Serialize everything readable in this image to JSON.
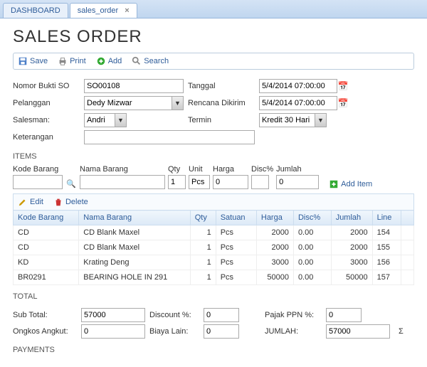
{
  "tabs": {
    "dashboard": "DASHBOARD",
    "sales_order": "sales_order"
  },
  "page_title": "SALES ORDER",
  "toolbar": {
    "save": "Save",
    "print": "Print",
    "add": "Add",
    "search": "Search"
  },
  "form": {
    "nomor_bukti_lbl": "Nomor Bukti SO",
    "nomor_bukti": "SO00108",
    "tanggal_lbl": "Tanggal",
    "tanggal": "5/4/2014 07:00:00",
    "pelanggan_lbl": "Pelanggan",
    "pelanggan": "Dedy Mizwar",
    "rencana_lbl": "Rencana Dikirim",
    "rencana": "5/4/2014 07:00:00",
    "salesman_lbl": "Salesman:",
    "salesman": "Andri",
    "termin_lbl": "Termin",
    "termin": "Kredit 30 Hari",
    "keterangan_lbl": "Keterangan",
    "keterangan": ""
  },
  "items_title": "ITEMS",
  "item_input": {
    "kode_lbl": "Kode Barang",
    "kode": "",
    "nama_lbl": "Nama Barang",
    "nama": "",
    "qty_lbl": "Qty",
    "qty": "1",
    "unit_lbl": "Unit",
    "unit": "Pcs",
    "harga_lbl": "Harga",
    "harga": "0",
    "disc_lbl": "Disc%",
    "disc": "",
    "jumlah_lbl": "Jumlah",
    "jumlah": "0",
    "add_item": "Add Item"
  },
  "grid_toolbar": {
    "edit": "Edit",
    "delete": "Delete"
  },
  "grid_headers": {
    "kode": "Kode Barang",
    "nama": "Nama Barang",
    "qty": "Qty",
    "satuan": "Satuan",
    "harga": "Harga",
    "disc": "Disc%",
    "jumlah": "Jumlah",
    "line": "Line"
  },
  "rows": [
    {
      "kode": "CD",
      "nama": "CD Blank Maxel",
      "qty": "1",
      "satuan": "Pcs",
      "harga": "2000",
      "disc": "0.00",
      "jumlah": "2000",
      "line": "154"
    },
    {
      "kode": "CD",
      "nama": "CD Blank Maxel",
      "qty": "1",
      "satuan": "Pcs",
      "harga": "2000",
      "disc": "0.00",
      "jumlah": "2000",
      "line": "155"
    },
    {
      "kode": "KD",
      "nama": "Krating Deng",
      "qty": "1",
      "satuan": "Pcs",
      "harga": "3000",
      "disc": "0.00",
      "jumlah": "3000",
      "line": "156"
    },
    {
      "kode": "BR0291",
      "nama": "BEARING HOLE IN 291",
      "qty": "1",
      "satuan": "Pcs",
      "harga": "50000",
      "disc": "0.00",
      "jumlah": "50000",
      "line": "157"
    }
  ],
  "total_title": "TOTAL",
  "totals": {
    "sub_lbl": "Sub Total:",
    "sub": "57000",
    "discount_lbl": "Discount %:",
    "discount": "0",
    "ppn_lbl": "Pajak PPN %:",
    "ppn": "0",
    "ongkos_lbl": "Ongkos Angkut:",
    "ongkos": "0",
    "biaya_lbl": "Biaya Lain:",
    "biaya": "0",
    "jumlah_lbl": "JUMLAH:",
    "jumlah": "57000"
  },
  "payments_title": "PAYMENTS"
}
